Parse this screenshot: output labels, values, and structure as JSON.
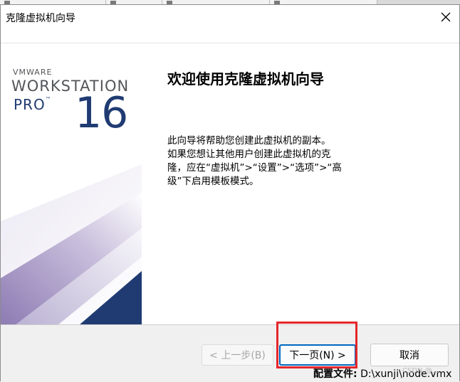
{
  "window": {
    "title": "克隆虚拟机向导"
  },
  "banner": {
    "brand": "VMWARE",
    "product": "WORKSTATION",
    "edition": "PRO",
    "trademark": "™",
    "version": "16"
  },
  "main": {
    "heading": "欢迎使用克隆虚拟机向导",
    "description_lines": [
      "此向导将帮助您创建此虚拟机的副本。",
      "如果您想让其他用户创建此虚拟机的克",
      "隆，应在“虚拟机”>“设置”>“选项”>“高",
      "级”下启用模板模式。"
    ]
  },
  "footer": {
    "back_label": "< 上一步(B)",
    "next_label": "下一页(N) >",
    "cancel_label": "取消"
  },
  "background": {
    "label": "配置文件:",
    "path": "D:\\xunji\\node.vmx",
    "watermark": "CSDN @..."
  },
  "colors": {
    "highlight": "#e5262a",
    "brand_navy": "#1f3b72",
    "primary_border": "#0067c0"
  }
}
